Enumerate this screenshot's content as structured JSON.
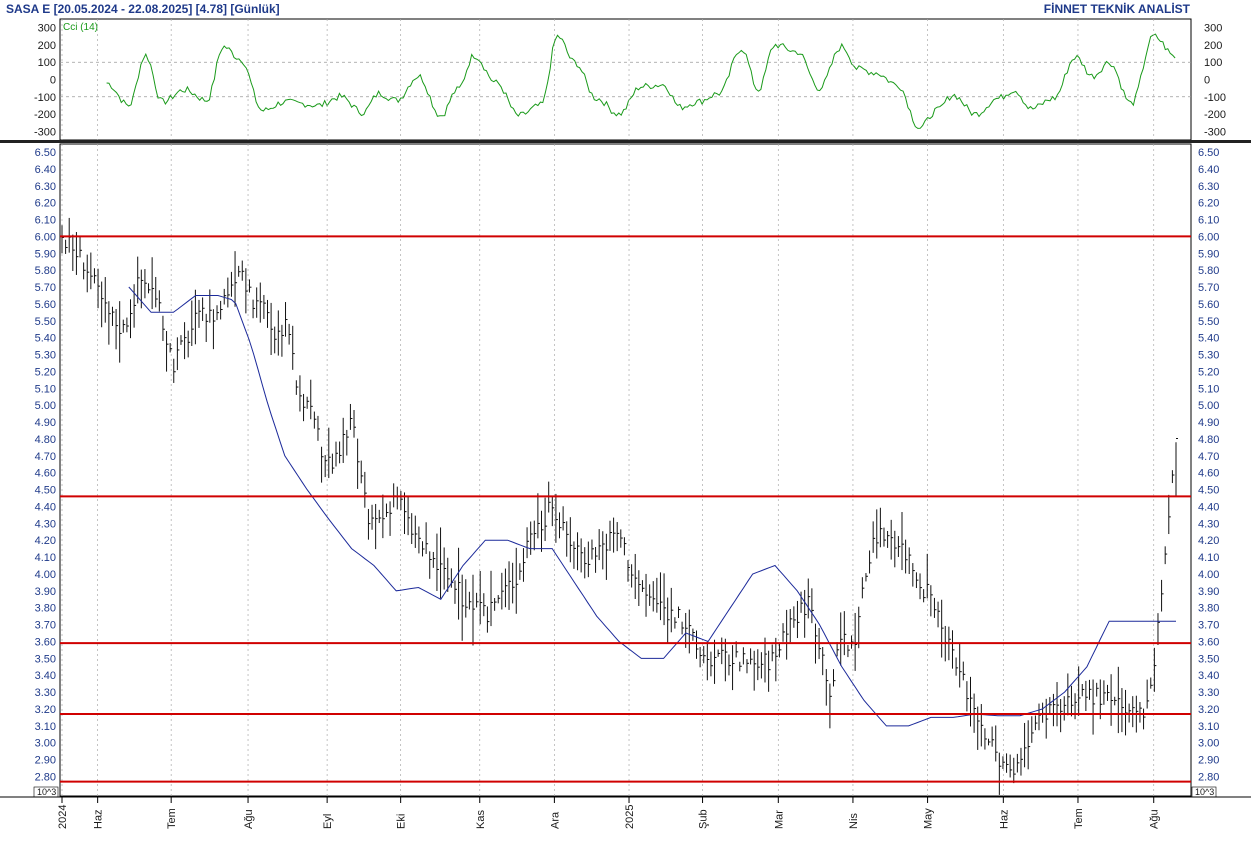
{
  "header": {
    "title": "SASA  E  [20.05.2024 - 22.08.2025]  [4.78]  [Günlük]",
    "brand": "FİNNET TEKNİK ANALİST"
  },
  "chart_data": [
    {
      "type": "line",
      "name": "Cci (14)",
      "ylim": [
        -350,
        350
      ],
      "yticks": [
        300,
        200,
        100,
        0,
        -100,
        -200,
        -300
      ],
      "gridlines": [
        100,
        -100
      ],
      "color": "#1a9a1a",
      "x": [
        0.04,
        0.06,
        0.075,
        0.09,
        0.11,
        0.13,
        0.145,
        0.16,
        0.18,
        0.2,
        0.215,
        0.23,
        0.25,
        0.27,
        0.285,
        0.3,
        0.32,
        0.34,
        0.355,
        0.37,
        0.39,
        0.41,
        0.43,
        0.445,
        0.46,
        0.48,
        0.5,
        0.52,
        0.54,
        0.555,
        0.57,
        0.59,
        0.61,
        0.625,
        0.64,
        0.66,
        0.68,
        0.7,
        0.715,
        0.73,
        0.75,
        0.77,
        0.785,
        0.8,
        0.82,
        0.84,
        0.855,
        0.87,
        0.89,
        0.91,
        0.925,
        0.94,
        0.96,
        0.98,
        1.0
      ],
      "y": [
        -20,
        -150,
        140,
        -130,
        -60,
        -120,
        190,
        120,
        -180,
        -130,
        -140,
        -150,
        -100,
        -190,
        -80,
        -120,
        20,
        -210,
        -60,
        140,
        -20,
        -210,
        -150,
        250,
        100,
        -110,
        -200,
        -40,
        -30,
        -160,
        -130,
        -80,
        180,
        -60,
        200,
        160,
        -50,
        190,
        60,
        40,
        -30,
        -280,
        -180,
        -90,
        -200,
        -110,
        -60,
        -170,
        -110,
        130,
        20,
        100,
        -140,
        250,
        130
      ]
    },
    {
      "type": "ohlc",
      "title": "SASA",
      "last": "4.78",
      "period": "Günlük",
      "date_range": [
        "20.05.2024",
        "22.08.2025"
      ],
      "ylim": [
        2.7,
        6.55
      ],
      "yticks": [
        6.5,
        6.4,
        6.3,
        6.2,
        6.1,
        6.0,
        5.9,
        5.8,
        5.7,
        5.6,
        5.5,
        5.4,
        5.3,
        5.2,
        5.1,
        5.0,
        4.9,
        4.8,
        4.7,
        4.6,
        4.5,
        4.4,
        4.3,
        4.2,
        4.1,
        4.0,
        3.9,
        3.8,
        3.7,
        3.6,
        3.5,
        3.4,
        3.3,
        3.2,
        3.1,
        3.0,
        2.9,
        2.8
      ],
      "horizontal_levels": [
        6.0,
        4.46,
        3.59,
        3.17,
        2.77
      ],
      "x_labels": [
        {
          "label": "2024",
          "pos": 0.0
        },
        {
          "label": "Haz",
          "pos": 0.032
        },
        {
          "label": "Tem",
          "pos": 0.098
        },
        {
          "label": "Ağu",
          "pos": 0.167
        },
        {
          "label": "Eyl",
          "pos": 0.238
        },
        {
          "label": "Eki",
          "pos": 0.304
        },
        {
          "label": "Kas",
          "pos": 0.375
        },
        {
          "label": "Ara",
          "pos": 0.442
        },
        {
          "label": "2025",
          "pos": 0.509
        },
        {
          "label": "Şub",
          "pos": 0.575
        },
        {
          "label": "Mar",
          "pos": 0.643
        },
        {
          "label": "Nis",
          "pos": 0.71
        },
        {
          "label": "May",
          "pos": 0.777
        },
        {
          "label": "Haz",
          "pos": 0.845
        },
        {
          "label": "Tem",
          "pos": 0.912
        },
        {
          "label": "Ağu",
          "pos": 0.98
        }
      ],
      "price_path": {
        "x": [
          0.0,
          0.02,
          0.04,
          0.055,
          0.07,
          0.08,
          0.09,
          0.1,
          0.12,
          0.14,
          0.16,
          0.17,
          0.18,
          0.19,
          0.2,
          0.21,
          0.22,
          0.225,
          0.235,
          0.245,
          0.26,
          0.275,
          0.29,
          0.3,
          0.31,
          0.33,
          0.35,
          0.36,
          0.38,
          0.39,
          0.41,
          0.42,
          0.43,
          0.44,
          0.45,
          0.47,
          0.49,
          0.5,
          0.51,
          0.52,
          0.54,
          0.56,
          0.57,
          0.58,
          0.6,
          0.62,
          0.64,
          0.65,
          0.66,
          0.67,
          0.68,
          0.69,
          0.7,
          0.71,
          0.72,
          0.73,
          0.74,
          0.75,
          0.76,
          0.77,
          0.78,
          0.79,
          0.8,
          0.81,
          0.82,
          0.83,
          0.84,
          0.85,
          0.86,
          0.87,
          0.88,
          0.89,
          0.9,
          0.92,
          0.94,
          0.96,
          0.97,
          0.98,
          0.99,
          1.0
        ],
        "y": [
          6.0,
          5.85,
          5.55,
          5.45,
          5.75,
          5.7,
          5.5,
          5.25,
          5.5,
          5.55,
          5.85,
          5.6,
          5.65,
          5.35,
          5.5,
          5.15,
          5.0,
          4.9,
          4.7,
          4.65,
          4.9,
          4.3,
          4.35,
          4.5,
          4.3,
          4.1,
          3.95,
          3.85,
          3.75,
          3.85,
          4.0,
          4.25,
          4.3,
          4.4,
          4.25,
          4.1,
          4.2,
          4.25,
          4.05,
          3.9,
          3.8,
          3.7,
          3.55,
          3.5,
          3.5,
          3.45,
          3.5,
          3.7,
          3.75,
          3.85,
          3.6,
          3.3,
          3.65,
          3.55,
          3.95,
          4.2,
          4.25,
          4.2,
          4.1,
          3.95,
          3.85,
          3.65,
          3.5,
          3.35,
          3.2,
          3.05,
          2.9,
          2.83,
          2.82,
          3.1,
          3.15,
          3.25,
          3.2,
          3.3,
          3.25,
          3.15,
          3.15,
          3.45,
          4.1,
          4.78
        ]
      },
      "moving_average": {
        "color": "#1c2a9a",
        "x": [
          0.06,
          0.08,
          0.1,
          0.12,
          0.14,
          0.155,
          0.17,
          0.185,
          0.2,
          0.22,
          0.24,
          0.26,
          0.28,
          0.3,
          0.32,
          0.34,
          0.36,
          0.38,
          0.4,
          0.42,
          0.44,
          0.46,
          0.48,
          0.5,
          0.52,
          0.54,
          0.56,
          0.58,
          0.6,
          0.62,
          0.64,
          0.66,
          0.68,
          0.7,
          0.72,
          0.74,
          0.76,
          0.78,
          0.8,
          0.82,
          0.84,
          0.86,
          0.88,
          0.9,
          0.92,
          0.94,
          0.96,
          0.97,
          0.98,
          0.99,
          1.0
        ],
        "y": [
          5.7,
          5.55,
          5.55,
          5.65,
          5.65,
          5.62,
          5.35,
          5.0,
          4.7,
          4.5,
          4.32,
          4.15,
          4.05,
          3.9,
          3.92,
          3.85,
          4.05,
          4.2,
          4.2,
          4.15,
          4.15,
          3.95,
          3.75,
          3.6,
          3.5,
          3.5,
          3.65,
          3.6,
          3.8,
          4.0,
          4.05,
          3.9,
          3.7,
          3.45,
          3.25,
          3.1,
          3.1,
          3.15,
          3.15,
          3.17,
          3.16,
          3.16,
          3.2,
          3.3,
          3.45,
          3.72,
          3.72,
          3.72,
          3.72,
          3.72,
          3.72
        ]
      }
    }
  ],
  "scale_note": "10^3"
}
